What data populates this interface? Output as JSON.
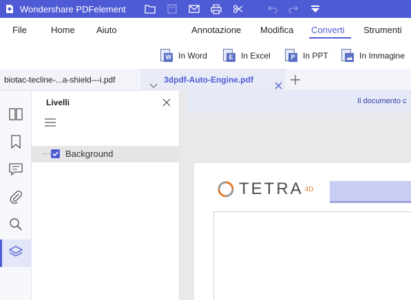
{
  "window": {
    "title": "Wondershare PDFelement",
    "brand_color": "#4f5bd5"
  },
  "quick_access": [
    {
      "icon": "folder-icon"
    },
    {
      "icon": "save-icon"
    },
    {
      "icon": "mail-icon"
    },
    {
      "icon": "print-icon"
    },
    {
      "icon": "scissors-icon"
    },
    {
      "icon": "undo-icon"
    },
    {
      "icon": "redo-icon"
    },
    {
      "icon": "dropdown-arrow-icon"
    }
  ],
  "menu": {
    "file": "File",
    "home": "Home",
    "help": "Aiuto",
    "annotate": "Annotazione",
    "edit": "Modifica",
    "convert": "Converti",
    "tools": "Strumenti",
    "active": "Converti"
  },
  "ribbon": {
    "to_word": {
      "label": "In Word",
      "badge": "W"
    },
    "to_excel": {
      "label": "In Excel",
      "badge": "E"
    },
    "to_ppt": {
      "label": "In PPT",
      "badge": "P"
    },
    "to_image": {
      "label": "In Immagine",
      "badge": ""
    }
  },
  "tabs": [
    {
      "label": "biotac-tecline-...a-shield---i.pdf",
      "active": false
    },
    {
      "label": "3dpdf-Auto-Engine.pdf",
      "active": true
    }
  ],
  "sidebar_rail": [
    {
      "icon": "thumbnails-icon"
    },
    {
      "icon": "bookmark-icon"
    },
    {
      "icon": "comment-icon"
    },
    {
      "icon": "attachment-icon"
    },
    {
      "icon": "search-icon"
    },
    {
      "icon": "layers-icon",
      "selected": true
    }
  ],
  "layers_panel": {
    "title": "Livelli",
    "layers": [
      {
        "label": "Background",
        "checked": true
      }
    ]
  },
  "document": {
    "notice": "Il documento c",
    "logo_text": "TETRA",
    "logo_superscript": "4D"
  }
}
